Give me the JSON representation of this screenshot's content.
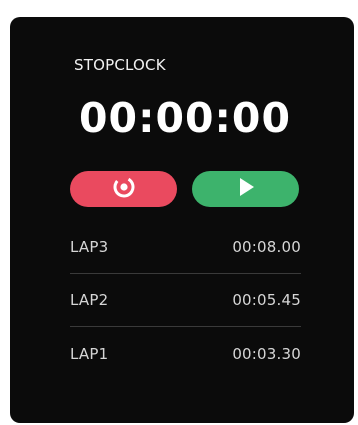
{
  "app": {
    "title": "STOPCLOCK",
    "display_time": "00:00:00"
  },
  "controls": {
    "reset_icon": "reset-icon",
    "play_icon": "play-icon",
    "reset_color": "#ea4a5f",
    "play_color": "#3db36c"
  },
  "laps": [
    {
      "name": "LAP3",
      "time": "00:08.00"
    },
    {
      "name": "LAP2",
      "time": "00:05.45"
    },
    {
      "name": "LAP1",
      "time": "00:03.30"
    }
  ]
}
